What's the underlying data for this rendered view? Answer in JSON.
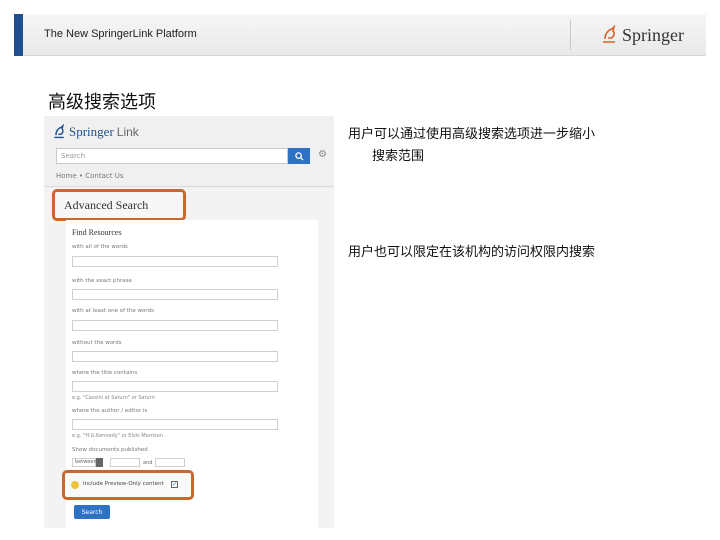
{
  "header": {
    "platform_title": "The New SpringerLink Platform",
    "logo_text": "Springer",
    "accent_color": "#1f4f8f"
  },
  "slide": {
    "heading": "高级搜索选项",
    "note1_line1": "用户可以通过使用高级搜索选项进一步缩小",
    "note1_line2": "搜索范围",
    "note2": "用户也可以限定在该机构的访问权限内搜索"
  },
  "screenshot": {
    "logo_springer": "Springer",
    "logo_link": "Link",
    "search_placeholder": "Search",
    "breadcrumb": "Home  •  Contact Us",
    "advanced_title": "Advanced Search",
    "form_heading": "Find Resources",
    "fields": [
      {
        "label": "with all of the words"
      },
      {
        "label": "with the exact phrase"
      },
      {
        "label": "with at least one of the words"
      },
      {
        "label": "without the words"
      },
      {
        "label": "where the title contains"
      },
      {
        "label": "where the author / editor is"
      }
    ],
    "hint_title": "e.g. \"Cassini at Saturn\" or Saturn",
    "hint_author": "e.g. \"H.G.Kennedy\" or Elvis Morrison",
    "date_label": "Show documents published",
    "date_select": "between",
    "date_and": "and",
    "preview_label": "Include Preview-Only content",
    "preview_checked": "✓",
    "search_button": "Search",
    "highlight_color": "#c8682e",
    "button_color": "#2e72c4"
  }
}
